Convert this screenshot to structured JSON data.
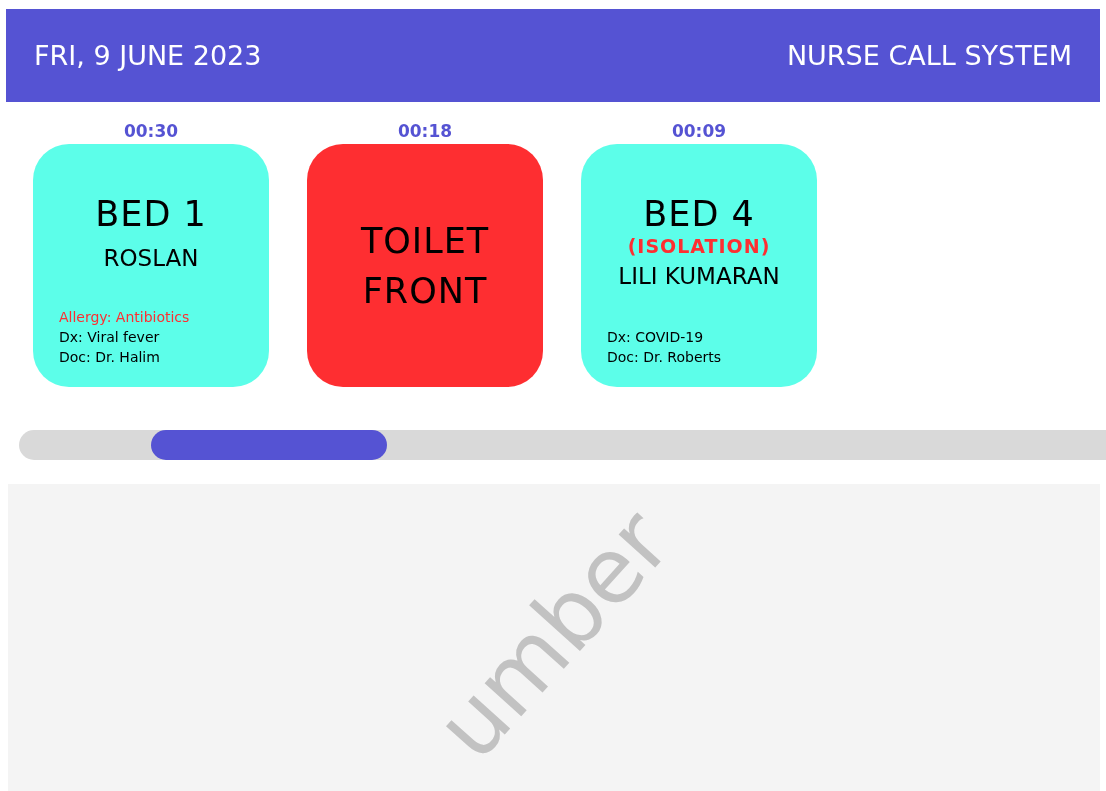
{
  "header": {
    "date": "FRI, 9 JUNE 2023",
    "title": "NURSE CALL SYSTEM"
  },
  "calls": [
    {
      "timer": "00:30",
      "color": "#5cfee9",
      "title": [
        "BED 1"
      ],
      "patient": "ROSLAN",
      "notes": [
        {
          "text": "Allergy: Antibiotics",
          "alert": true
        },
        {
          "text": "Dx: Viral fever",
          "alert": false
        },
        {
          "text": "Doc: Dr. Halim",
          "alert": false
        }
      ]
    },
    {
      "timer": "00:18",
      "color": "#fe2e31",
      "title": [
        "TOILET",
        "FRONT"
      ]
    },
    {
      "timer": "00:09",
      "color": "#5cfee9",
      "title": [
        "BED 4"
      ],
      "tag": "(ISOLATION)",
      "patient": "LILI KUMARAN",
      "notes": [
        {
          "text": "Dx: COVID-19",
          "alert": false
        },
        {
          "text": "Doc: Dr. Roberts",
          "alert": false
        }
      ]
    }
  ],
  "panel": {
    "text": "umber"
  }
}
